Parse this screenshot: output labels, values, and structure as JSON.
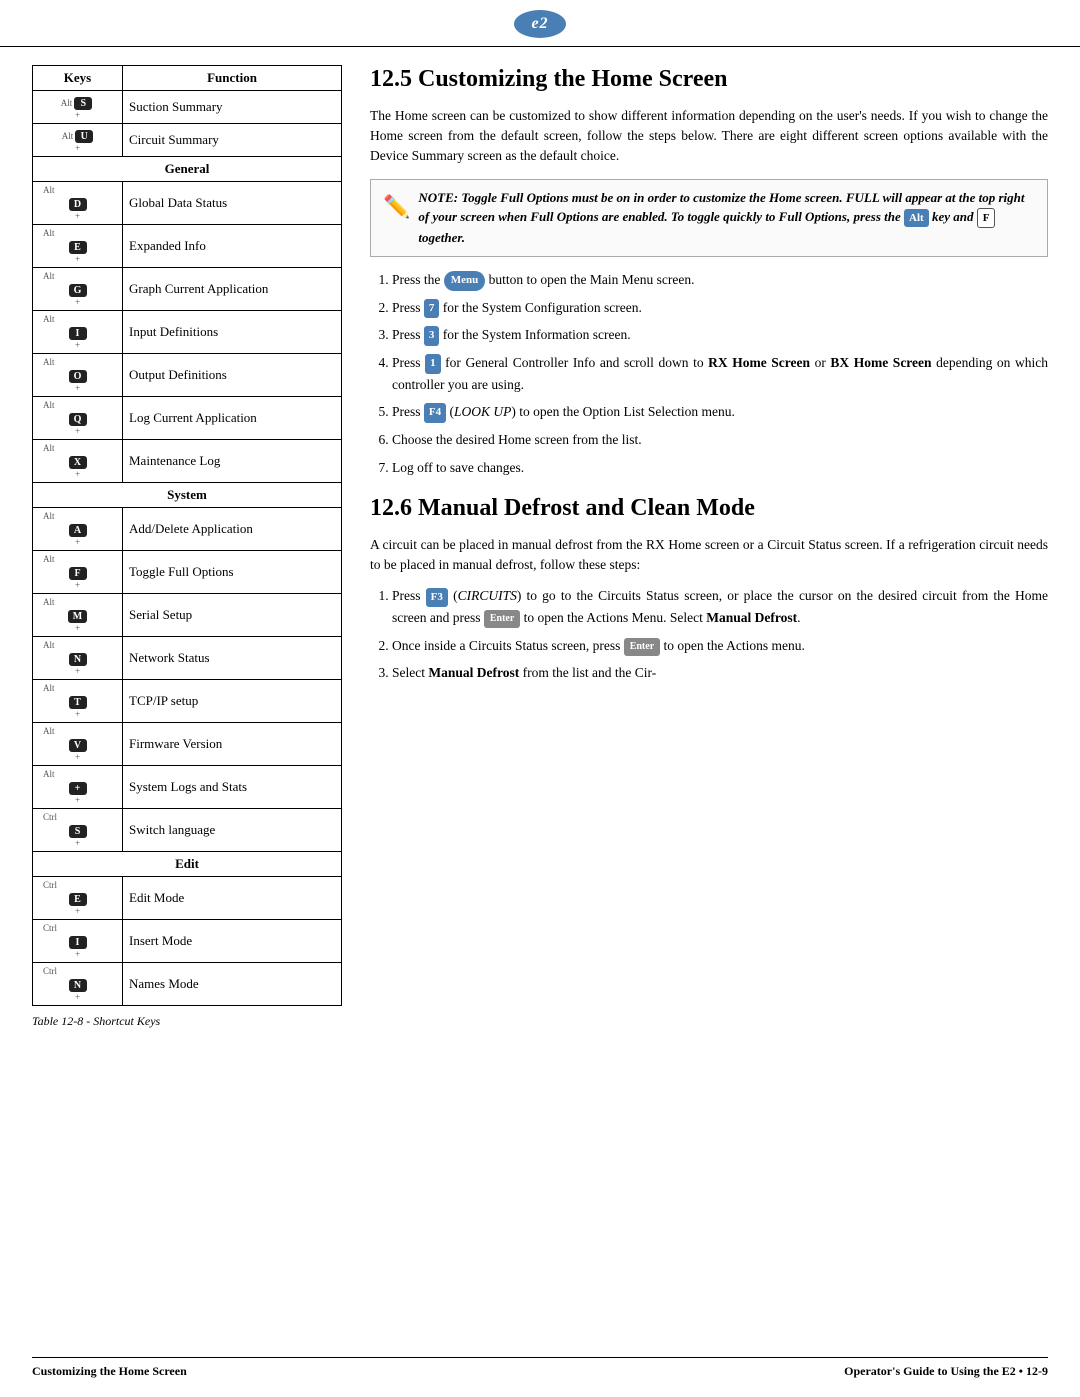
{
  "logo": {
    "text": "e2"
  },
  "table": {
    "headers": [
      "Keys",
      "Function"
    ],
    "caption": "Table 12-8 - Shortcut Keys",
    "rows": [
      {
        "keys": "Alt+S",
        "function": "Suction Summary",
        "section": null
      },
      {
        "keys": "Alt+U",
        "function": "Circuit Summary",
        "section": null
      },
      {
        "keys": "General",
        "function": "",
        "section": true
      },
      {
        "keys": "Alt+D",
        "function": "Global Data Status",
        "section": null
      },
      {
        "keys": "Alt+E",
        "function": "Expanded Info",
        "section": null
      },
      {
        "keys": "Alt+G",
        "function": "Graph Current Application",
        "section": null
      },
      {
        "keys": "Alt+I",
        "function": "Input Definitions",
        "section": null
      },
      {
        "keys": "Alt+O",
        "function": "Output Definitions",
        "section": null
      },
      {
        "keys": "Alt+Q",
        "function": "Log Current Application",
        "section": null
      },
      {
        "keys": "Alt+X",
        "function": "Maintenance Log",
        "section": null
      },
      {
        "keys": "System",
        "function": "",
        "section": true
      },
      {
        "keys": "Alt+A",
        "function": "Add/Delete Application",
        "section": null
      },
      {
        "keys": "Alt+F",
        "function": "Toggle Full Options",
        "section": null
      },
      {
        "keys": "Alt+M",
        "function": "Serial Setup",
        "section": null
      },
      {
        "keys": "Alt+N",
        "function": "Network Status",
        "section": null
      },
      {
        "keys": "Alt+T",
        "function": "TCP/IP setup",
        "section": null
      },
      {
        "keys": "Alt+V",
        "function": "Firmware Version",
        "section": null
      },
      {
        "keys": "Alt++",
        "function": "System Logs and Stats",
        "section": null
      },
      {
        "keys": "Ctrl+S",
        "function": "Switch language",
        "section": null
      },
      {
        "keys": "Edit",
        "function": "",
        "section": true
      },
      {
        "keys": "Ctrl+E",
        "function": "Edit Mode",
        "section": null
      },
      {
        "keys": "Ctrl+I",
        "function": "Insert Mode",
        "section": null
      },
      {
        "keys": "Ctrl+N",
        "function": "Names Mode",
        "section": null
      }
    ]
  },
  "section125": {
    "title": "12.5  Customizing the Home Screen",
    "body1": "The Home screen can be customized to show different information depending on the user's needs. If you wish to change the Home screen from the default screen, follow the steps below. There are eight different screen options available with the Device Summary screen as the default choice.",
    "note": "NOTE: Toggle Full Options must be on in order to customize the Home screen. FULL will appear at the top right of your screen when Full Options are enabled. To toggle quickly to Full Options, press the Alt key and F together.",
    "steps": [
      "Press the Menu button to open the Main Menu screen.",
      "Press 7 for the System Configuration screen.",
      "Press 3 for the System Information screen.",
      "Press 1 for General Controller Info and scroll down to RX Home Screen or BX Home Screen depending on which controller you are using.",
      "Press F4 (LOOK UP) to open the Option List Selection menu.",
      "Choose the desired Home screen from the list.",
      "Log off to save changes."
    ]
  },
  "section126": {
    "title": "12.6  Manual Defrost and Clean Mode",
    "body1": "A circuit can be placed in manual defrost from the RX Home screen or a Circuit Status screen. If a refrigeration circuit needs to be placed in manual defrost, follow these steps:",
    "steps": [
      "Press F3 (CIRCUITS) to go to the Circuits Status screen, or place the cursor on the desired circuit from the Home screen and press Enter to open the Actions Menu. Select Manual Defrost.",
      "Once inside a Circuits Status screen, press Enter to open the Actions menu.",
      "Select Manual Defrost from the list and the Cir-"
    ]
  },
  "footer": {
    "left": "Customizing the Home Screen",
    "right": "Operator's Guide to Using the E2 • 12-9"
  }
}
